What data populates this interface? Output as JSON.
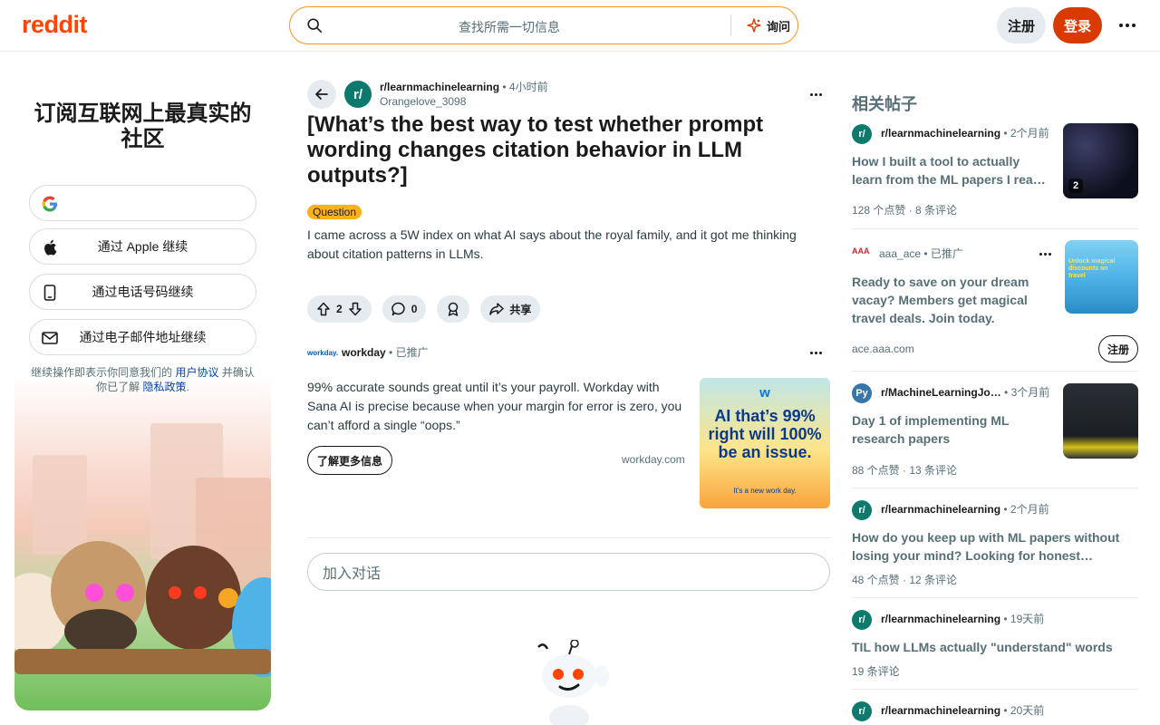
{
  "header": {
    "logo": "reddit",
    "search_placeholder": "查找所需一切信息",
    "ask_label": "询问",
    "signup_label": "注册",
    "login_label": "登录"
  },
  "signup": {
    "title": "订阅互联网上最真实的社区",
    "google_label": "",
    "apple_label": "通过 Apple 继续",
    "phone_label": "通过电话号码继续",
    "email_label": "通过电子邮件地址继续",
    "legal_prefix": "继续操作即表示你同意我们的 ",
    "legal_terms": "用户协议",
    "legal_mid": " 并确认你已了解 ",
    "legal_privacy": "隐私政策",
    "legal_suffix": "."
  },
  "post": {
    "subreddit": "r/learnmachinelearning",
    "time": "• 4小时前",
    "author": "Orangelove_3098",
    "title": "[What’s the best way to test whether prompt wording changes citation behavior in LLM outputs?]",
    "flair": "Question",
    "body": "I came across a 5W index on what AI says about the royal family, and it got me thinking about citation patterns in LLMs.",
    "votes": "2",
    "comments": "0",
    "share_label": "共享"
  },
  "ad": {
    "logo_text": "workday.",
    "name": "workday",
    "promoted": "• 已推广",
    "text": "99% accurate sounds great until it’s your payroll. Workday with Sana AI is precise because when your margin for error is zero, you can’t afford a single “oops.”",
    "cta": "了解更多信息",
    "domain": "workday.com",
    "img_logo": "w",
    "img_headline": "AI that’s 99% right will 100% be an issue.",
    "img_tagline": "It’s a new work day."
  },
  "comment_placeholder": "加入对话",
  "related": {
    "heading": "相关帖子",
    "items": [
      {
        "sub": "r/learnmachinelearning",
        "time": "• 2个月前",
        "title": "How I built a tool to actually learn from the ML papers I rea…",
        "stats": "128 个点赞 · 8 条评论",
        "thumb_badge": "2"
      },
      {
        "sub": "aaa_ace",
        "time": "• 已推广",
        "title": "Ready to save on your dream vacay? Members get magical travel deals. Join today.",
        "stats": "ace.aaa.com",
        "cta": "注册",
        "thumb_text": "Unlock magical discounts on travel"
      },
      {
        "sub": "r/MachineLearningJo…",
        "time": "• 3个月前",
        "title": "Day 1 of implementing ML research papers",
        "stats": "88 个点赞 · 13 条评论"
      },
      {
        "sub": "r/learnmachinelearning",
        "time": "• 2个月前",
        "title": "How do you keep up with ML papers without losing your mind? Looking for honest…",
        "stats": "48 个点赞 · 12 条评论"
      },
      {
        "sub": "r/learnmachinelearning",
        "time": "• 19天前",
        "title": "TIL how LLMs actually \"understand\" words",
        "stats": "19 条评论"
      },
      {
        "sub": "r/learnmachinelearning",
        "time": "• 20天前",
        "title": "",
        "stats": ""
      }
    ]
  },
  "colors": {
    "brand": "#ff4500",
    "login": "#d93a00",
    "search_border": "#f7931e",
    "flair": "#fbb117",
    "sub_avatar": "#0e7a6e"
  }
}
